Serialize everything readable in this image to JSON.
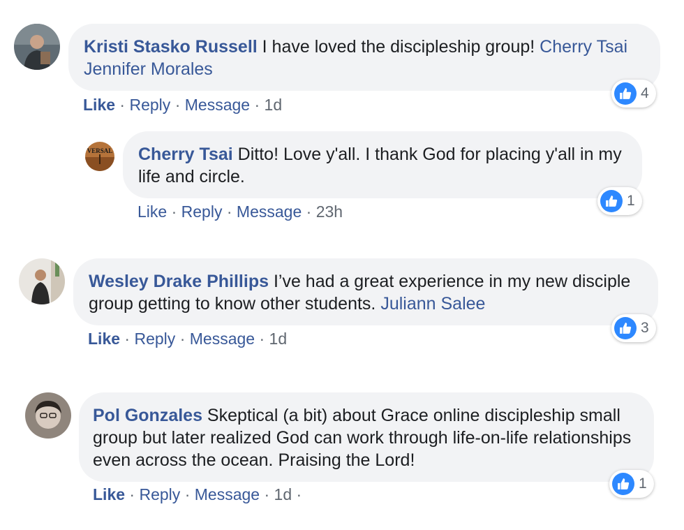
{
  "colors": {
    "author_link": "#385898",
    "bubble_bg": "#f2f3f5",
    "reaction_blue": "#2d88ff",
    "meta_gray": "#606770"
  },
  "comments": [
    {
      "author": "Kristi Stasko Russell",
      "text": " I have loved the discipleship group! ",
      "mentions": [
        "Cherry Tsai",
        "Jennifer Morales"
      ],
      "actions": {
        "like": "Like",
        "reply": "Reply",
        "message": "Message",
        "time": "1d",
        "sep": "·"
      },
      "reaction": {
        "icon": "thumbs-up-icon",
        "count": "4"
      },
      "reply": {
        "author": "Cherry Tsai",
        "text": " Ditto! Love y'all. I thank God for placing y'all in my life and circle.",
        "avatar_text": "VERSAL",
        "actions": {
          "like": "Like",
          "reply": "Reply",
          "message": "Message",
          "time": "23h",
          "sep": "·"
        },
        "reaction": {
          "icon": "thumbs-up-icon",
          "count": "1"
        }
      }
    },
    {
      "author": "Wesley Drake Phillips",
      "text": " I’ve had a great experience in my new disciple group getting to know other students. ",
      "mentions": [
        "Juliann Salee"
      ],
      "actions": {
        "like": "Like",
        "reply": "Reply",
        "message": "Message",
        "time": "1d",
        "sep": "·"
      },
      "reaction": {
        "icon": "thumbs-up-icon",
        "count": "3"
      }
    },
    {
      "author": "Pol Gonzales",
      "text": " Skeptical (a bit) about Grace online discipleship small group but later realized God can work through life-on-life relationships even across the ocean. Praising the Lord!",
      "actions": {
        "like": "Like",
        "reply": "Reply",
        "message": "Message",
        "time": "1d",
        "sep": "·",
        "trailing_sep": "·"
      },
      "reaction": {
        "icon": "thumbs-up-icon",
        "count": "1"
      }
    }
  ]
}
